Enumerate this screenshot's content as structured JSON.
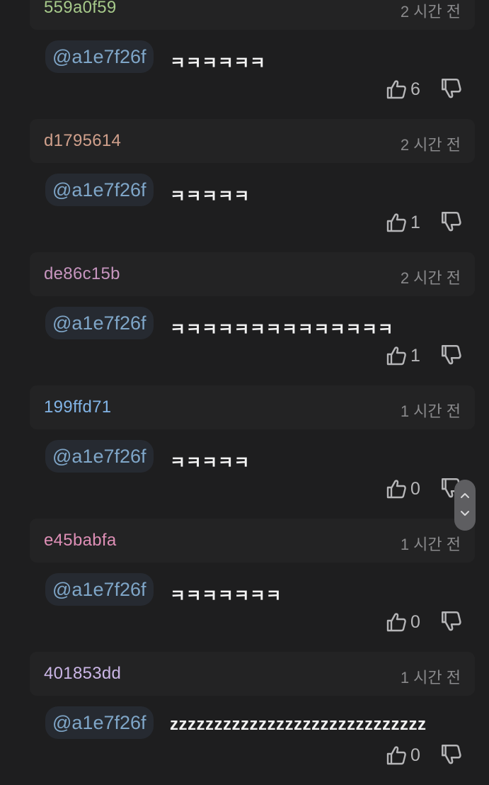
{
  "comments": [
    {
      "author": "559a0f59",
      "author_color": "#a6c98a",
      "time": "2 시간 전",
      "mention": "@a1e7f26f",
      "text": "ㅋㅋㅋㅋㅋㅋ",
      "likes": "6"
    },
    {
      "author": "d1795614",
      "author_color": "#d0a08c",
      "time": "2 시간 전",
      "mention": "@a1e7f26f",
      "text": "ㅋㅋㅋㅋㅋ",
      "likes": "1"
    },
    {
      "author": "de86c15b",
      "author_color": "#c795bf",
      "time": "2 시간 전",
      "mention": "@a1e7f26f",
      "text": "ㅋㅋㅋㅋㅋㅋㅋㅋㅋㅋㅋㅋㅋㅋ",
      "likes": "1"
    },
    {
      "author": "199ffd71",
      "author_color": "#82b4e6",
      "time": "1 시간 전",
      "mention": "@a1e7f26f",
      "text": "ㅋㅋㅋㅋㅋ",
      "likes": "0"
    },
    {
      "author": "e45babfa",
      "author_color": "#de8fb6",
      "time": "1 시간 전",
      "mention": "@a1e7f26f",
      "text": "ㅋㅋㅋㅋㅋㅋㅋ",
      "likes": "0"
    },
    {
      "author": "401853dd",
      "author_color": "#cbb6e6",
      "time": "1 시간 전",
      "mention": "@a1e7f26f",
      "text": "zzzzzzzzzzzzzzzzzzzzzzzzzzzzz",
      "likes": "0"
    }
  ],
  "icons": {
    "like": "thumbs-up-icon",
    "dislike": "thumbs-down-icon",
    "scroll_up": "chevron-up-icon",
    "scroll_down": "chevron-down-icon"
  }
}
